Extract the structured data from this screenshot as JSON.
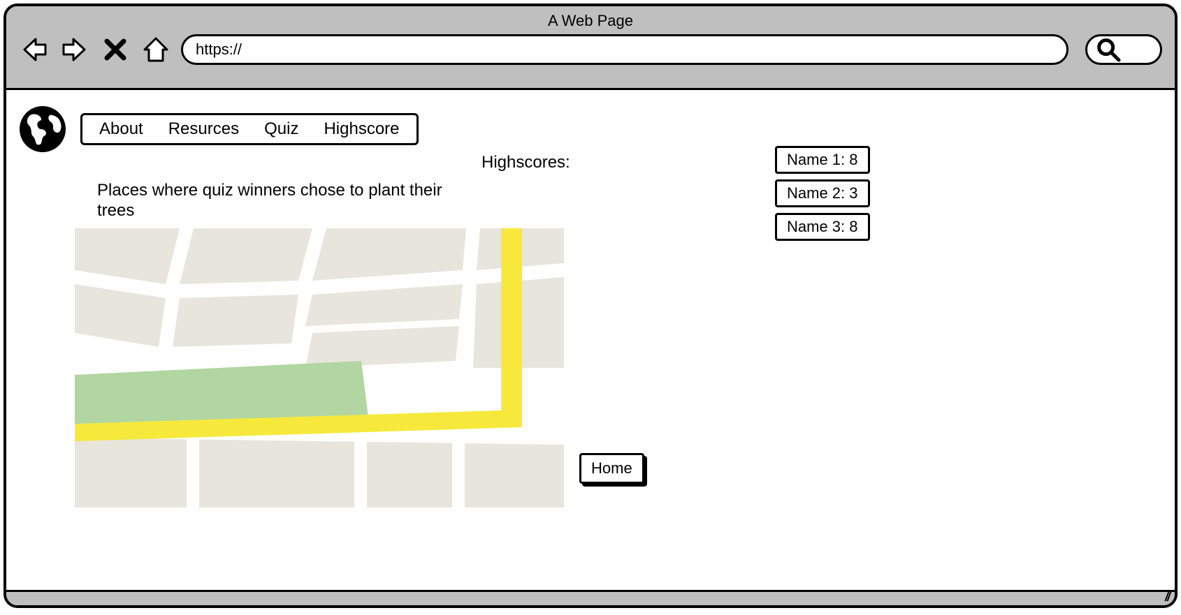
{
  "chrome": {
    "title": "A Web Page",
    "url": "https://"
  },
  "nav": {
    "items": [
      "About",
      "Resurces",
      "Quiz",
      "Highscore"
    ]
  },
  "highscores": {
    "title": "Highscores:",
    "entries": [
      {
        "display": "Name 1: 8"
      },
      {
        "display": "Name 2: 3"
      },
      {
        "display": "Name 3: 8"
      }
    ]
  },
  "map": {
    "caption": "Places where quiz winners chose to plant their trees"
  },
  "buttons": {
    "home": "Home"
  }
}
